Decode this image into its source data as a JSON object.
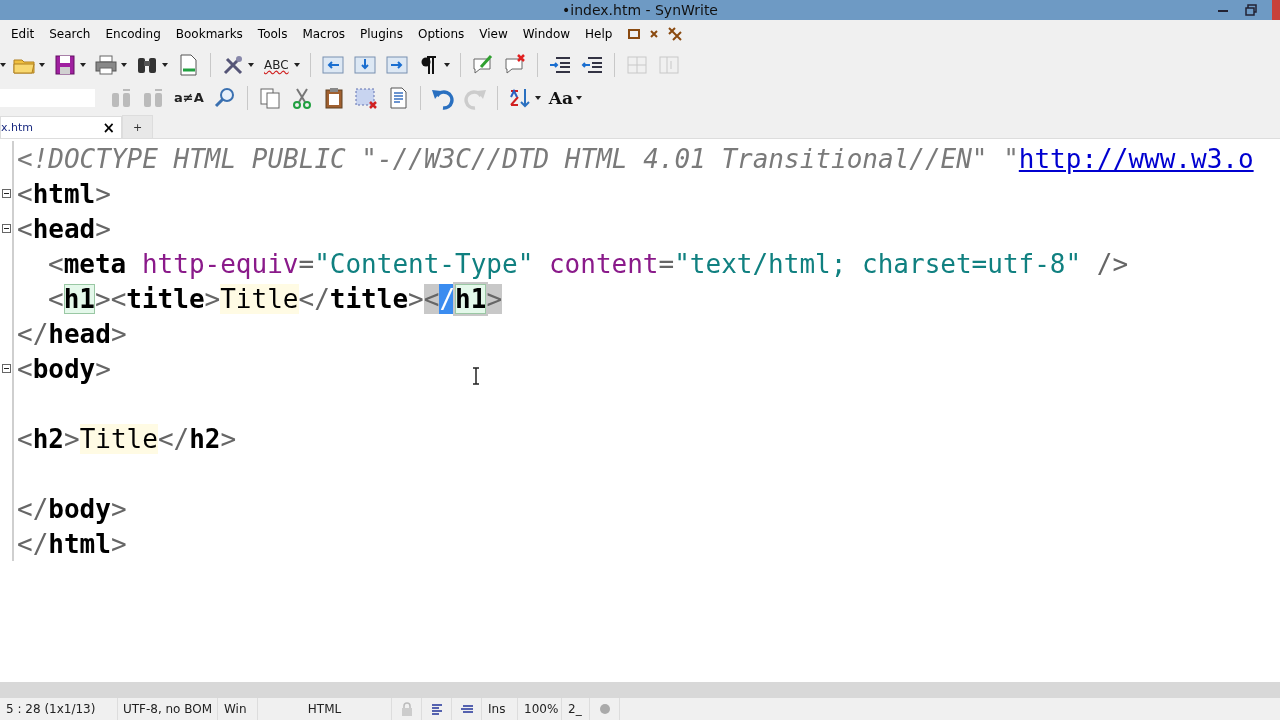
{
  "window": {
    "title": "•index.htm - SynWrite"
  },
  "menu": [
    "Edit",
    "Search",
    "Encoding",
    "Bookmarks",
    "Tools",
    "Macros",
    "Plugins",
    "Options",
    "View",
    "Window",
    "Help"
  ],
  "toolbar": {
    "spell_label": "ABC",
    "case_label": "a≠A",
    "font_label": "Aa"
  },
  "tabs": [
    {
      "label": "x.htm",
      "selected": true,
      "close": "×"
    },
    {
      "label": "+",
      "selected": false
    }
  ],
  "editor": {
    "lines": [
      {
        "fold": false,
        "indented": false,
        "tokens": [
          {
            "kind": "doctype",
            "text": "<!DOCTYPE HTML PUBLIC \"-//W3C//DTD HTML 4.01 Transitional//EN\" \""
          },
          {
            "kind": "link",
            "text": "http://www.w3.o"
          }
        ]
      },
      {
        "fold": true,
        "indented": false,
        "tokens": [
          {
            "kind": "punct",
            "text": "<"
          },
          {
            "kind": "tag",
            "text": "html"
          },
          {
            "kind": "punct",
            "text": ">"
          }
        ]
      },
      {
        "fold": true,
        "indented": false,
        "tokens": [
          {
            "kind": "punct",
            "text": "<"
          },
          {
            "kind": "tag",
            "text": "head"
          },
          {
            "kind": "punct",
            "text": ">"
          }
        ]
      },
      {
        "fold": false,
        "indented": true,
        "tokens": [
          {
            "kind": "punct",
            "text": "<"
          },
          {
            "kind": "tag",
            "text": "meta "
          },
          {
            "kind": "attr",
            "text": "http-equiv"
          },
          {
            "kind": "punct",
            "text": "="
          },
          {
            "kind": "value",
            "text": "\"Content-Type\" "
          },
          {
            "kind": "attr",
            "text": "content"
          },
          {
            "kind": "punct",
            "text": "="
          },
          {
            "kind": "value",
            "text": "\"text/html; charset=utf-8\" "
          },
          {
            "kind": "punct",
            "text": "/>"
          }
        ]
      },
      {
        "fold": false,
        "indented": true,
        "tokens": [
          {
            "kind": "punct",
            "text": "<"
          },
          {
            "kind": "tag_match",
            "text": "h1"
          },
          {
            "kind": "punct",
            "text": ">"
          },
          {
            "kind": "punct",
            "text": "<"
          },
          {
            "kind": "tag",
            "text": "title"
          },
          {
            "kind": "punct",
            "text": ">"
          },
          {
            "kind": "text_word",
            "text": "Title"
          },
          {
            "kind": "punct",
            "text": "</"
          },
          {
            "kind": "tag",
            "text": "title"
          },
          {
            "kind": "punct",
            "text": ">"
          },
          {
            "kind": "punct_selected",
            "text": "<"
          },
          {
            "kind": "punct_caret",
            "text": "/"
          },
          {
            "kind": "tag_selected_match",
            "text": "h1"
          },
          {
            "kind": "punct_selected",
            "text": ">"
          }
        ]
      },
      {
        "fold": false,
        "indented": false,
        "tokens": [
          {
            "kind": "punct",
            "text": "</"
          },
          {
            "kind": "tag",
            "text": "head"
          },
          {
            "kind": "punct",
            "text": ">"
          }
        ]
      },
      {
        "fold": true,
        "indented": false,
        "tokens": [
          {
            "kind": "punct",
            "text": "<"
          },
          {
            "kind": "tag",
            "text": "body"
          },
          {
            "kind": "punct",
            "text": ">"
          }
        ]
      },
      {
        "fold": false
      },
      {
        "fold": false,
        "indented": false,
        "tokens": [
          {
            "kind": "punct",
            "text": "<"
          },
          {
            "kind": "tag",
            "text": "h2"
          },
          {
            "kind": "punct",
            "text": ">"
          },
          {
            "kind": "text_word",
            "text": "Title"
          },
          {
            "kind": "punct",
            "text": "</"
          },
          {
            "kind": "tag",
            "text": "h2"
          },
          {
            "kind": "punct",
            "text": ">"
          }
        ]
      },
      {
        "fold": false
      },
      {
        "fold": false,
        "indented": false,
        "tokens": [
          {
            "kind": "punct",
            "text": "</"
          },
          {
            "kind": "tag",
            "text": "body"
          },
          {
            "kind": "punct",
            "text": ">"
          }
        ]
      },
      {
        "fold": false,
        "indented": false,
        "tokens": [
          {
            "kind": "punct",
            "text": "</"
          },
          {
            "kind": "tag",
            "text": "html"
          },
          {
            "kind": "punct",
            "text": ">"
          }
        ]
      }
    ]
  },
  "status_bar": {
    "position": "5 : 28 (1x1/13)",
    "encoding": "UTF-8, no BOM",
    "line_ending": "Win",
    "lexer": "HTML",
    "mode": "Ins",
    "zoom": "100%",
    "extra": "2_"
  }
}
